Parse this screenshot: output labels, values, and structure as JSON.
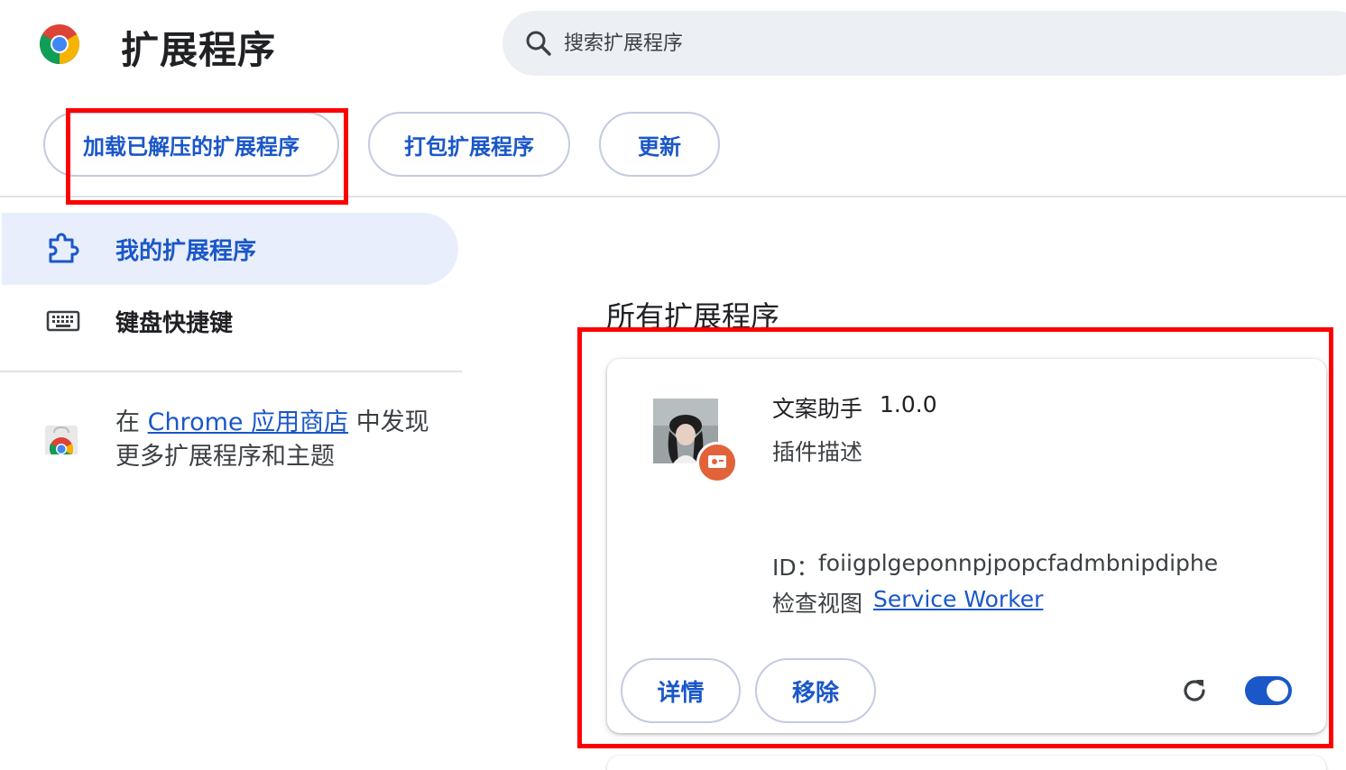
{
  "header": {
    "title": "扩展程序",
    "logo_icon": "chrome-logo-icon",
    "search": {
      "placeholder": "搜索扩展程序",
      "value": "",
      "icon": "search-icon"
    }
  },
  "toolbar": {
    "load_unpacked": "加载已解压的扩展程序",
    "pack_extension": "打包扩展程序",
    "update": "更新"
  },
  "sidebar": {
    "items": [
      {
        "label": "我的扩展程序",
        "icon": "puzzle-icon",
        "active": true
      },
      {
        "label": "键盘快捷键",
        "icon": "keyboard-icon",
        "active": false
      }
    ],
    "store_promo": {
      "prefix": "在",
      "link_text": "Chrome 应用商店",
      "suffix": "中发现",
      "line2": "更多扩展程序和主题",
      "icon": "web-store-icon"
    }
  },
  "main": {
    "section_title": "所有扩展程序",
    "extensions": [
      {
        "name": "文案助手",
        "version": "1.0.0",
        "description": "插件描述",
        "id_label": "ID：",
        "id": "foiigplgeponnpjpopcfadmbnipdiphe",
        "views_label": "检查视图",
        "views_link": "Service Worker",
        "details_label": "详情",
        "remove_label": "移除",
        "enabled": true,
        "reload_icon": "reload-icon"
      }
    ]
  },
  "annotations": {
    "highlight_color": "#ff0000"
  },
  "colors": {
    "accent": "#1a57c8",
    "active_nav_bg": "#e8eefb",
    "search_bg": "#eceff4"
  }
}
